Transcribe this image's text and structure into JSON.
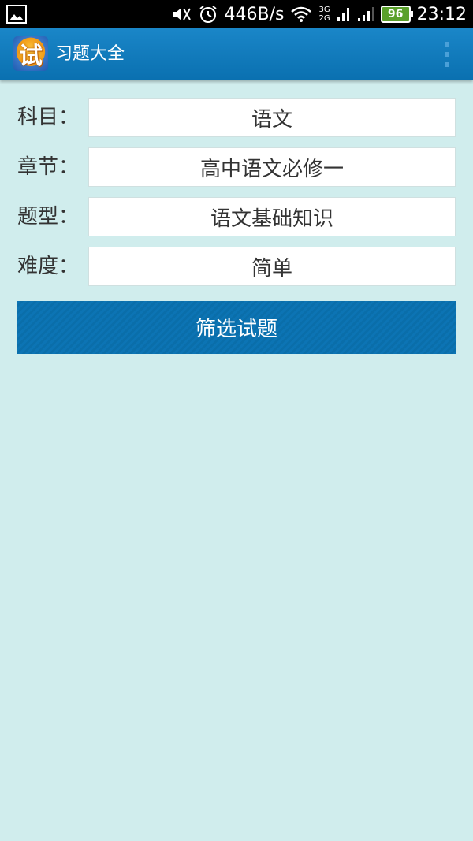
{
  "status_bar": {
    "network_speed": "446B/s",
    "network_type_top": "3G",
    "network_type_bottom": "2G",
    "battery": "96",
    "time": "23:12"
  },
  "app_bar": {
    "logo_char": "试",
    "title": "习题大全",
    "overflow_icon": "more-vertical-icon"
  },
  "form": {
    "subject": {
      "label": "科目：",
      "value": "语文"
    },
    "chapter": {
      "label": "章节：",
      "value": "高中语文必修一"
    },
    "question_type": {
      "label": "题型：",
      "value": "语文基础知识"
    },
    "difficulty": {
      "label": "难度：",
      "value": "简单"
    }
  },
  "filter_button": {
    "label": "筛选试题"
  },
  "colors": {
    "background": "#d0eded",
    "app_bar": "#0a70b0",
    "button": "#0c74b4",
    "status_bar": "#000000"
  }
}
